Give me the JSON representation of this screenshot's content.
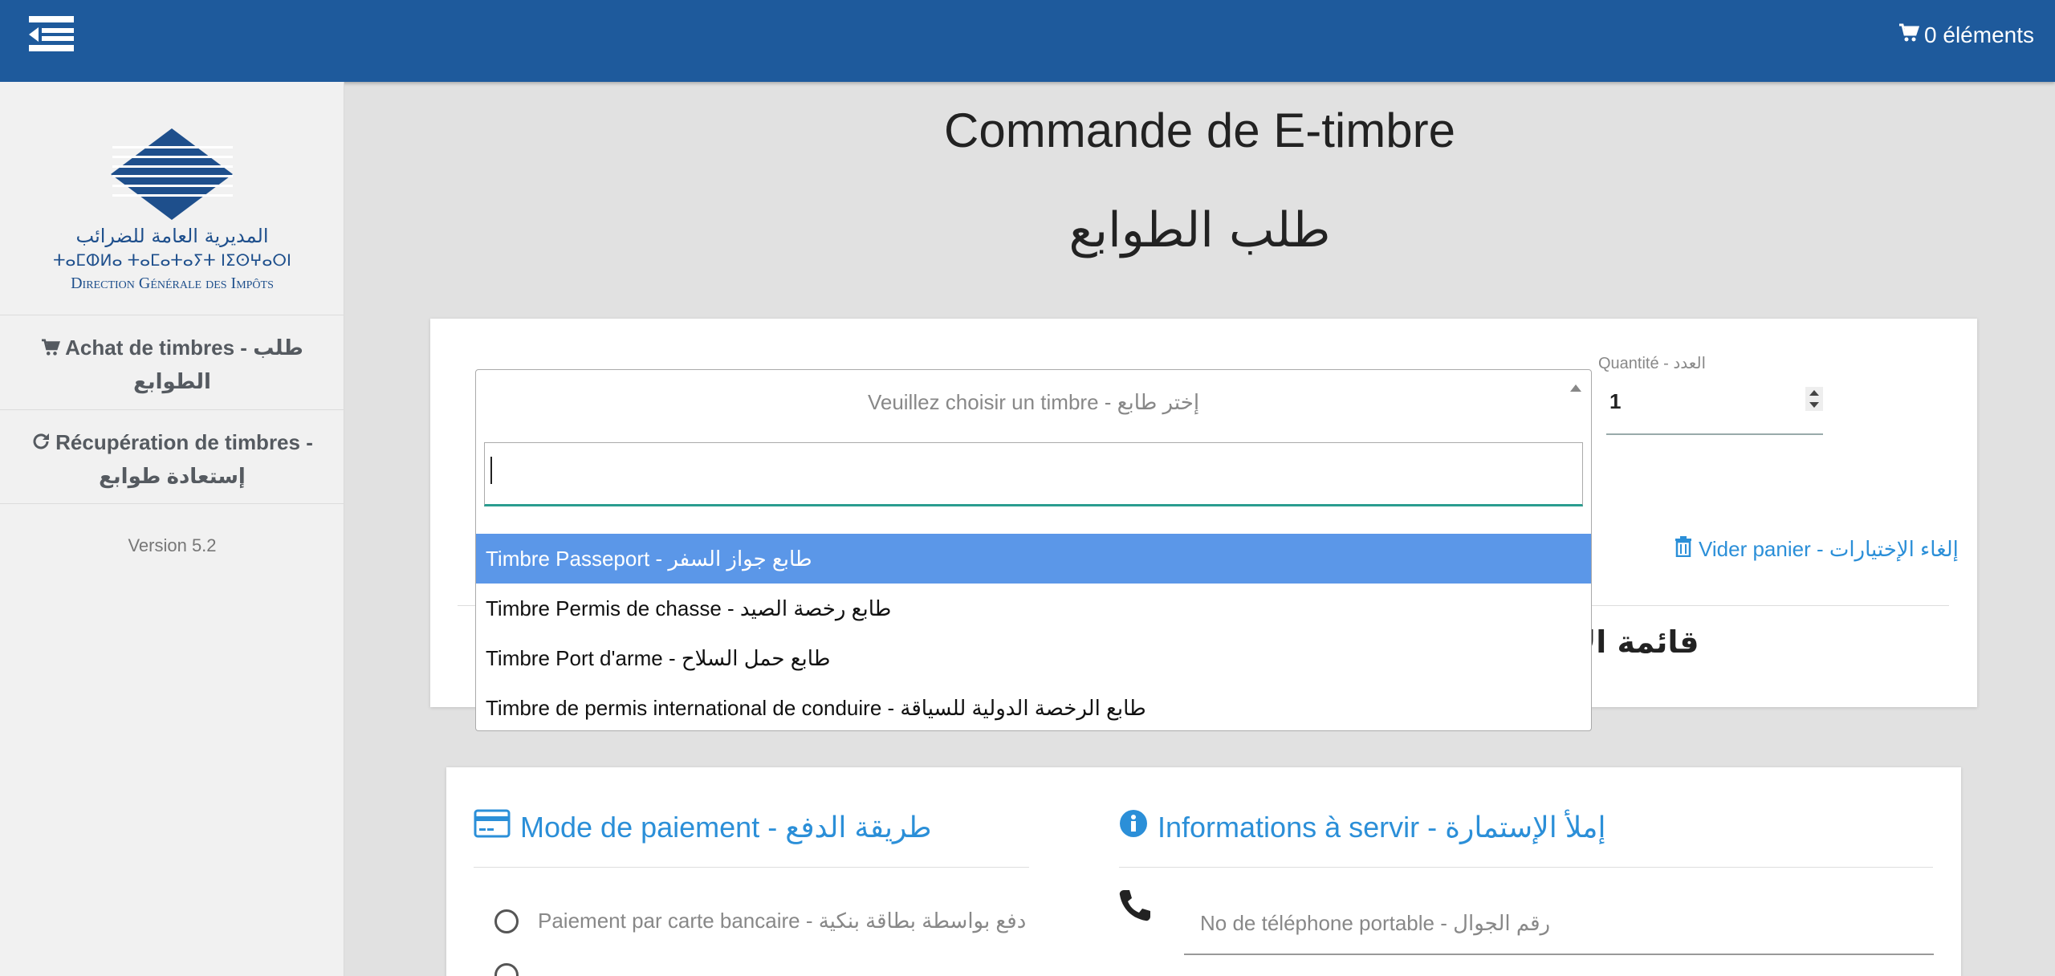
{
  "topbar": {
    "menu_icon": "menu-collapse-icon",
    "cart_icon": "cart-icon",
    "cart_label": "0 éléments",
    "color": "#1e5a9c"
  },
  "sidebar": {
    "logo": {
      "line_ar": "المديرية العامة للضرائب",
      "line_tif": "ⵜⴰⵎⵀⵍⴰ ⵜⴰⵎⴰⵜⴰⵢⵜ ⵏⵉⵙⵖⴰⵔⵏ",
      "line_fr": "Direction Générale des Impôts"
    },
    "items": [
      {
        "icon": "cart-icon",
        "label": "Achat de timbres - طلب الطوابع"
      },
      {
        "icon": "refresh-icon",
        "label": "Récupération de timbres - إستعادة طوابع"
      }
    ],
    "version": "Version 5.2"
  },
  "page": {
    "title_fr": "Commande de E-timbre",
    "title_ar": "طلب الطوابع"
  },
  "order": {
    "select_placeholder": "Veuillez choisir un timbre - إختر طابع",
    "search_value": "",
    "options": [
      {
        "label": "Timbre Passeport - طابع جواز السفر",
        "selected": true
      },
      {
        "label": "Timbre Permis de chasse - طابع رخصة الصيد",
        "selected": false
      },
      {
        "label": "Timbre Port d'arme - طابع حمل السلاح",
        "selected": false
      },
      {
        "label": "Timbre de permis international de conduire - طابع الرخصة الدولية للسياقة",
        "selected": false
      }
    ],
    "quantity_label": "Quantité - العدد",
    "quantity_value": "1",
    "clear_icon": "trash-icon",
    "clear_label": "Vider panier - إلغاء الإختيارات",
    "list_title": "قائمة الإ"
  },
  "payment": {
    "icon": "credit-card-icon",
    "title": "Mode de paiement - طريقة الدفع",
    "options": [
      {
        "label": "Paiement par carte bancaire - دفع بواسطة بطاقة بنكية"
      }
    ]
  },
  "info": {
    "icon": "info-icon",
    "title": "Informations à servir - إملأ الإستمارة",
    "phone_icon": "phone-icon",
    "phone_placeholder": "No de téléphone portable - رقم الجوال"
  },
  "colors": {
    "accent": "#2b8fd8",
    "selected_option": "#5b97e8",
    "search_focus": "#2a9d8f"
  }
}
